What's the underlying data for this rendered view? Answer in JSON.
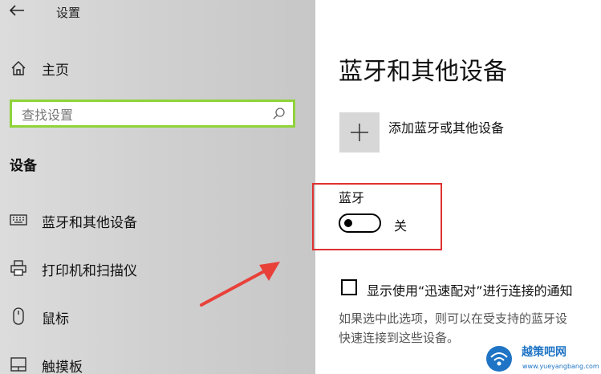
{
  "window": {
    "title": "设置"
  },
  "sidebar": {
    "home_label": "主页",
    "search": {
      "placeholder": "查找设置",
      "value": ""
    },
    "section_title": "设备",
    "items": [
      {
        "label": "蓝牙和其他设备",
        "icon": "bluetooth-devices-icon"
      },
      {
        "label": "打印机和扫描仪",
        "icon": "printer-icon"
      },
      {
        "label": "鼠标",
        "icon": "mouse-icon"
      },
      {
        "label": "触摸板",
        "icon": "touchpad-icon"
      }
    ]
  },
  "main": {
    "title": "蓝牙和其他设备",
    "add_device_label": "添加蓝牙或其他设备",
    "bluetooth": {
      "label": "蓝牙",
      "state_label": "关",
      "on": false
    },
    "swift_pair": {
      "label": "显示使用“迅速配对”进行连接的通知",
      "checked": false,
      "description_lines": [
        "如果选中此选项，则可以在受支持的蓝牙设",
        "快速连接到这些设备。"
      ]
    }
  },
  "watermark": {
    "text": "越策吧网",
    "url": "www.yueyangbang.com"
  },
  "colors": {
    "highlight": "#e03131",
    "search_border": "#8fd33a",
    "arrow": "#e8413a",
    "watermark": "#1f74c5"
  }
}
